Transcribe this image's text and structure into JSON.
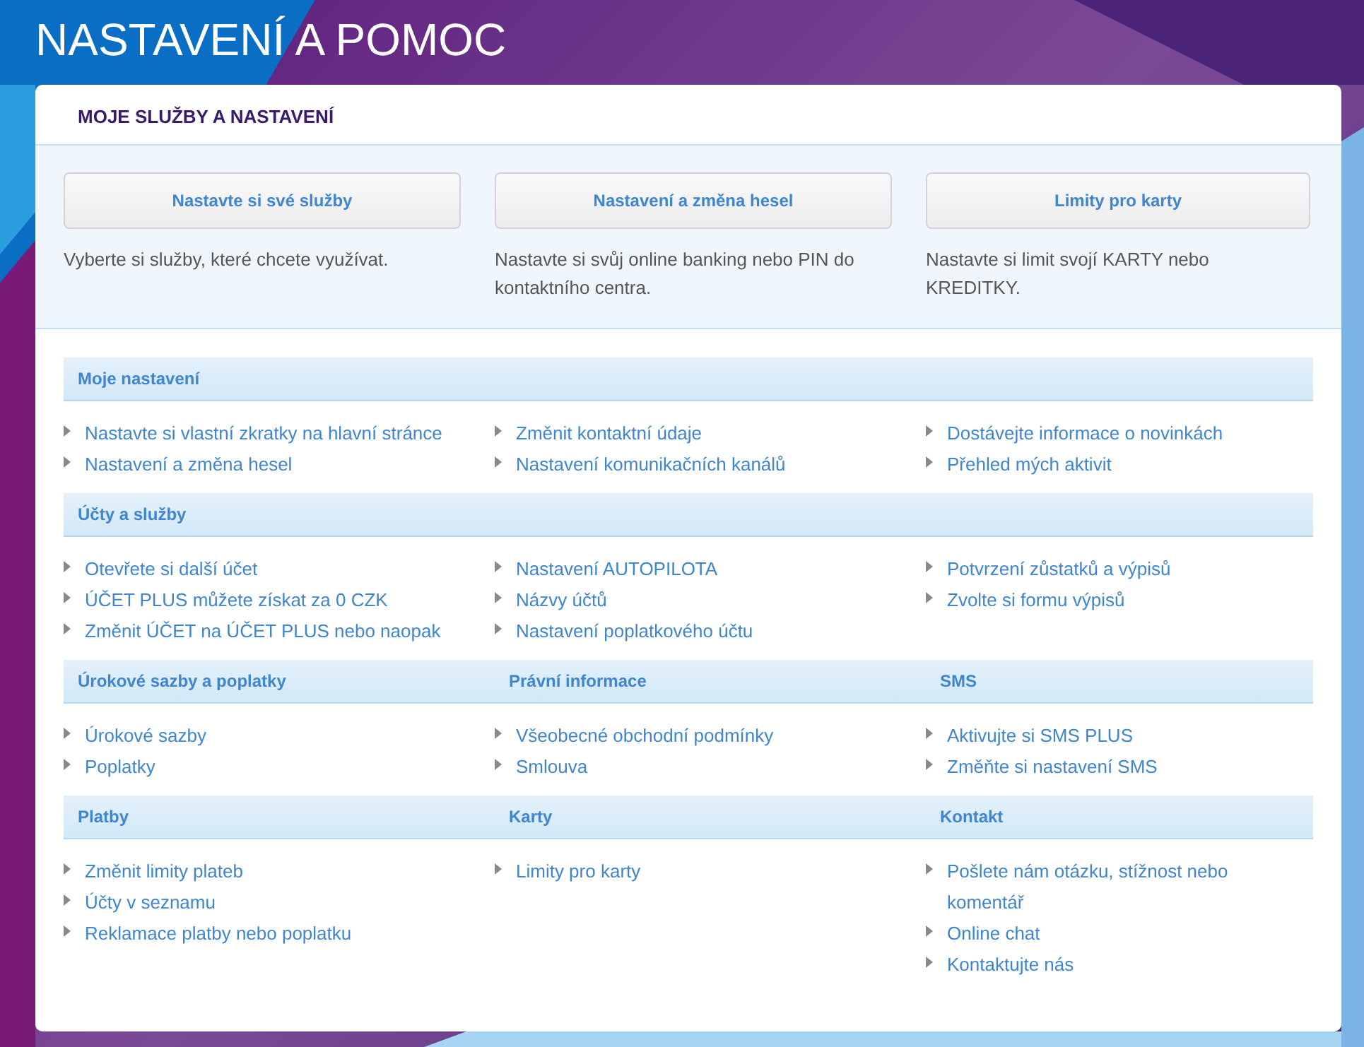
{
  "page_title": "NASTAVENÍ A POMOC",
  "card": {
    "title": "MOJE SLUŽBY A NASTAVENÍ",
    "quick_actions": [
      {
        "button": "Nastavte si své služby",
        "description": "Vyberte si služby, které chcete využívat."
      },
      {
        "button": "Nastavení a změna hesel",
        "description": "Nastavte si svůj online banking nebo PIN do kontaktního centra."
      },
      {
        "button": "Limity pro karty",
        "description": "Nastavte si limit svojí KARTY nebo KREDITKY."
      }
    ],
    "sections": [
      {
        "headings": [
          "Moje nastavení"
        ],
        "columns": [
          [
            "Nastavte si vlastní zkratky na hlavní stránce",
            "Nastavení a změna hesel"
          ],
          [
            "Změnit kontaktní údaje",
            "Nastavení komunikačních kanálů"
          ],
          [
            "Dostávejte informace o novinkách",
            "Přehled mých aktivit"
          ]
        ]
      },
      {
        "headings": [
          "Účty a služby"
        ],
        "columns": [
          [
            "Otevřete si další účet",
            "ÚČET PLUS můžete získat za 0 CZK",
            "Změnit ÚČET na ÚČET PLUS nebo naopak"
          ],
          [
            "Nastavení AUTOPILOTA",
            "Názvy účtů",
            "Nastavení poplatkového účtu"
          ],
          [
            "Potvrzení zůstatků a výpisů",
            "Zvolte si formu výpisů"
          ]
        ]
      },
      {
        "headings": [
          "Úrokové sazby a poplatky",
          "Právní informace",
          "SMS"
        ],
        "columns": [
          [
            "Úrokové sazby",
            "Poplatky"
          ],
          [
            "Všeobecné obchodní podmínky",
            "Smlouva"
          ],
          [
            "Aktivujte si SMS PLUS",
            "Změňte si nastavení SMS"
          ]
        ]
      },
      {
        "headings": [
          "Platby",
          "Karty",
          "Kontakt"
        ],
        "columns": [
          [
            "Změnit limity plateb",
            "Účty v seznamu",
            "Reklamace platby nebo poplatku"
          ],
          [
            "Limity pro karty"
          ],
          [
            "Pošlete nám otázku, stížnost nebo komentář",
            "Online chat",
            "Kontaktujte nás"
          ]
        ]
      }
    ]
  }
}
